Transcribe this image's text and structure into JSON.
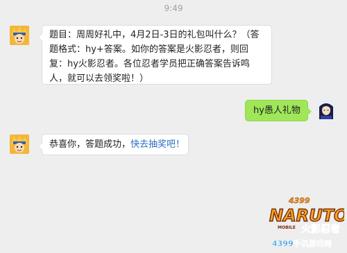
{
  "time": "9:49",
  "messages": [
    {
      "from": "bot",
      "text": "题目：周周好礼中，4月2日-3日的礼包叫什么？（答题格式：hy+答案。如你的答案是火影忍者，则回复：hy火影忍者。各位忍者学员把正确答案告诉鸣人，就可以去领奖啦！）"
    },
    {
      "from": "me",
      "text": "hy愚人礼物"
    },
    {
      "from": "bot",
      "text": "恭喜你，答题成功，",
      "link": "快去抽奖吧！"
    }
  ],
  "watermark": {
    "top": "4399",
    "brand": "NARUTO",
    "sub": "火影忍者",
    "mobile": "MOBILE",
    "site": "4399手机游戏网"
  },
  "colors": {
    "background": "#eeeeee",
    "my_bubble": "#9fe658",
    "link": "#2b6fc1"
  }
}
